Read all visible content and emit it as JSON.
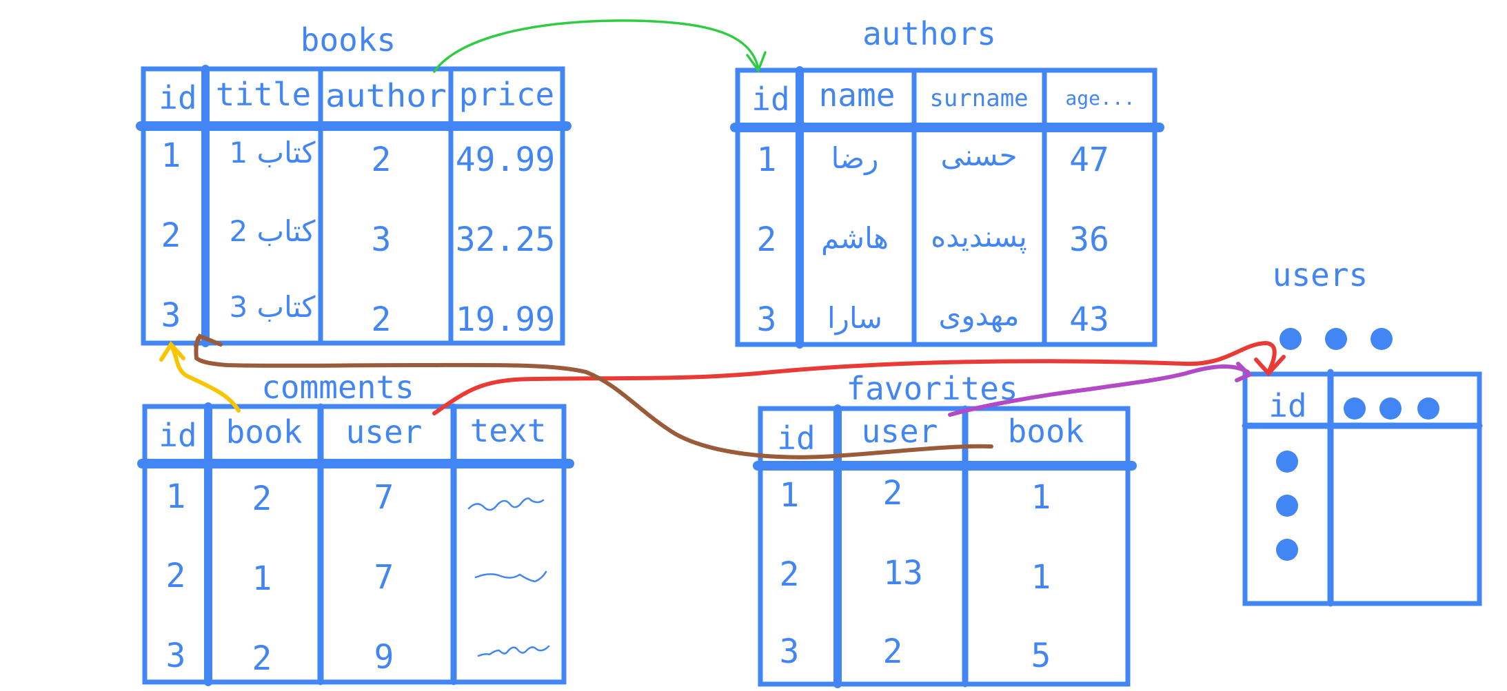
{
  "colors": {
    "table_blue": "#4285f4",
    "arrow_green": "#2ecc40",
    "arrow_red": "#ea3a35",
    "arrow_purple": "#b24ac7",
    "arrow_brown": "#9a5b3b",
    "arrow_yellow": "#f7c600"
  },
  "tables": {
    "books": {
      "title": "books",
      "columns": [
        "id",
        "title",
        "author",
        "price"
      ],
      "rows": [
        [
          "1",
          "1 كتاب",
          "2",
          "49.99"
        ],
        [
          "2",
          "2 كتاب",
          "3",
          "32.25"
        ],
        [
          "3",
          "3 كتاب",
          "2",
          "19.99"
        ]
      ]
    },
    "authors": {
      "title": "authors",
      "columns": [
        "id",
        "name",
        "surname",
        "age..."
      ],
      "rows": [
        [
          "1",
          "رضا",
          "حسنی",
          "47"
        ],
        [
          "2",
          "هاشم",
          "پسندیده",
          "36"
        ],
        [
          "3",
          "سارا",
          "مهدوی",
          "43"
        ]
      ]
    },
    "comments": {
      "title": "comments",
      "columns": [
        "id",
        "book",
        "user",
        "text"
      ],
      "rows": [
        [
          "1",
          "2",
          "7",
          ""
        ],
        [
          "2",
          "1",
          "7",
          ""
        ],
        [
          "3",
          "2",
          "9",
          ""
        ]
      ]
    },
    "favorites": {
      "title": "favorites",
      "columns": [
        "id",
        "user",
        "book"
      ],
      "rows": [
        [
          "1",
          "2",
          "1"
        ],
        [
          "2",
          "13",
          "1"
        ],
        [
          "3",
          "2",
          "5"
        ]
      ]
    },
    "users": {
      "title": "users",
      "columns": [
        "id"
      ]
    }
  },
  "relations": [
    {
      "from": "books.author",
      "to": "authors.id",
      "color": "green"
    },
    {
      "from": "comments.user",
      "to": "users.id",
      "color": "red"
    },
    {
      "from": "favorites.user",
      "to": "users.id",
      "color": "purple"
    },
    {
      "from": "favorites.book",
      "to": "books.id",
      "color": "brown"
    },
    {
      "from": "comments.book",
      "to": "books.id",
      "color": "yellow"
    }
  ]
}
